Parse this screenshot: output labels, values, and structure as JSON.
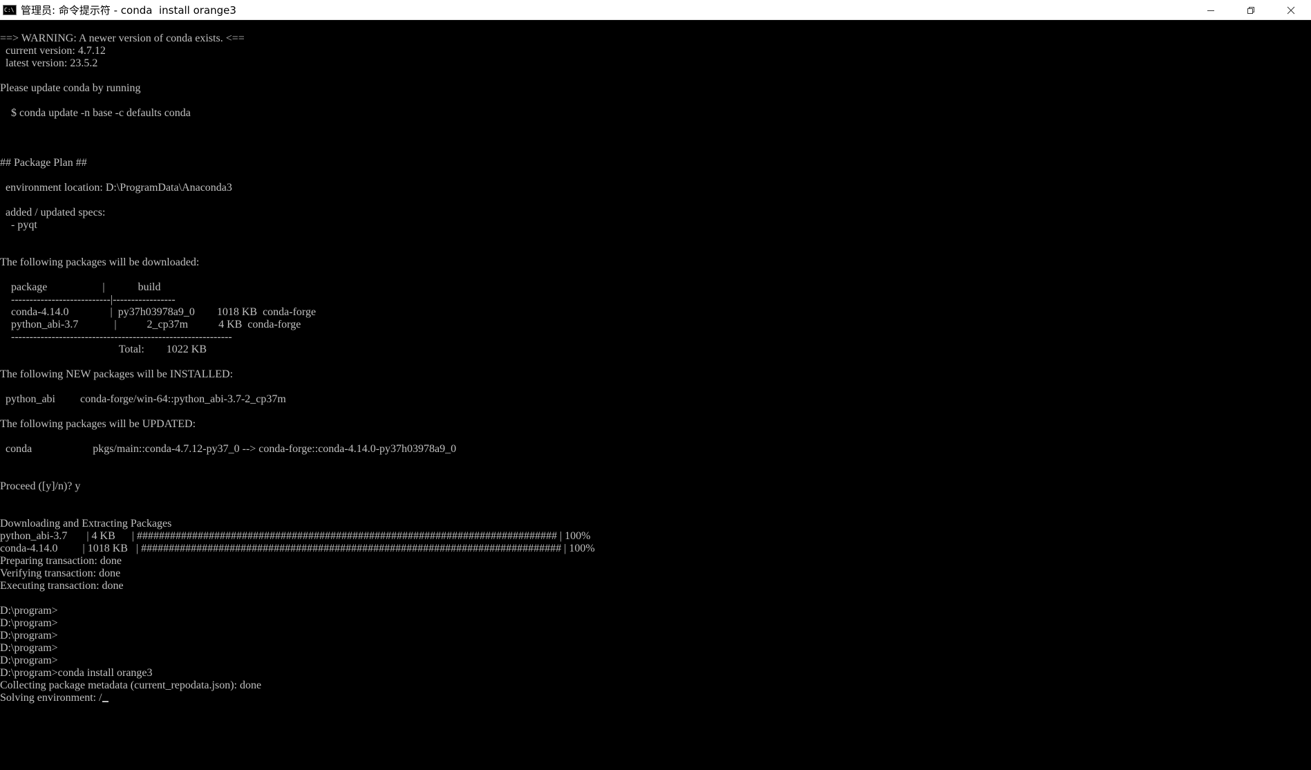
{
  "window": {
    "title": "管理员: 命令提示符 - conda  install orange3",
    "icon_label": "C:\\",
    "controls": {
      "minimize": "minimize-icon",
      "maximize": "restore-icon",
      "close": "close-icon"
    }
  },
  "console": {
    "text_color": "#c0c0c0",
    "background": "#000000",
    "lines": [
      "==> WARNING: A newer version of conda exists. <==",
      "  current version: 4.7.12",
      "  latest version: 23.5.2",
      "",
      "Please update conda by running",
      "",
      "    $ conda update -n base -c defaults conda",
      "",
      "",
      "",
      "## Package Plan ##",
      "",
      "  environment location: D:\\ProgramData\\Anaconda3",
      "",
      "  added / updated specs:",
      "    - pyqt",
      "",
      "",
      "The following packages will be downloaded:",
      "",
      "    package                    |            build",
      "    ---------------------------|-----------------",
      "    conda-4.14.0               |  py37h03978a9_0        1018 KB  conda-forge",
      "    python_abi-3.7             |           2_cp37m           4 KB  conda-forge",
      "    ------------------------------------------------------------",
      "                                           Total:        1022 KB",
      "",
      "The following NEW packages will be INSTALLED:",
      "",
      "  python_abi         conda-forge/win-64::python_abi-3.7-2_cp37m",
      "",
      "The following packages will be UPDATED:",
      "",
      "  conda                      pkgs/main::conda-4.7.12-py37_0 --> conda-forge::conda-4.14.0-py37h03978a9_0",
      "",
      "",
      "Proceed ([y]/n)? y",
      "",
      "",
      "Downloading and Extracting Packages",
      "python_abi-3.7       | 4 KB      | ############################################################################ | 100%",
      "conda-4.14.0         | 1018 KB   | ############################################################################ | 100%",
      "Preparing transaction: done",
      "Verifying transaction: done",
      "Executing transaction: done",
      "",
      "D:\\program>",
      "D:\\program>",
      "D:\\program>",
      "D:\\program>",
      "D:\\program>",
      "D:\\program>conda install orange3",
      "Collecting package metadata (current_repodata.json): done",
      "Solving environment: /"
    ]
  }
}
